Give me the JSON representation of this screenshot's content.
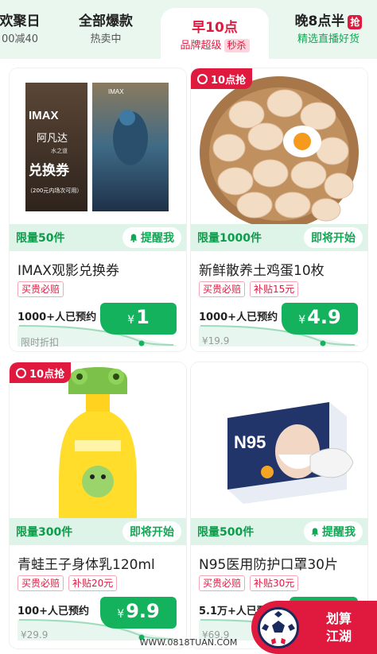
{
  "tabs": [
    {
      "title": "欢聚日",
      "subtitle": "00减40",
      "active": false
    },
    {
      "title": "全部爆款",
      "subtitle": "热卖中",
      "active": false
    },
    {
      "title": "早10点",
      "subtitle": "品牌超级",
      "flash": "秒杀",
      "active": true
    },
    {
      "title": "晚8点半",
      "badge": "抢",
      "subtitle": "精选直播好货",
      "active": false
    }
  ],
  "products": [
    {
      "image": "IMAX阿凡达兑换券",
      "image_text": {
        "brand": "IMAX",
        "movie": "阿凡达",
        "movie_sub": "水之道",
        "voucher": "兑换券",
        "note": "（200元内场次可用）"
      },
      "limit": "限量50件",
      "action": "提醒我",
      "action_icon": "bell-icon",
      "title": "IMAX观影兑换券",
      "tags": [
        "买贵必赔"
      ],
      "booked": "1000+人已预约",
      "currency": "¥",
      "price": "1",
      "sub": "限时折扣",
      "progress": 0.85
    },
    {
      "image": "鸡蛋",
      "badge": "10点抢",
      "limit": "限量1000件",
      "action": "即将开始",
      "title": "新鲜散养土鸡蛋10枚",
      "tags": [
        "买贵必赔",
        "补贴15元"
      ],
      "booked": "1000+人已预约",
      "currency": "¥",
      "price": "4.9",
      "sub": "¥19.9",
      "progress": 0.85
    },
    {
      "image": "青蛙王子身体乳",
      "badge": "10点抢",
      "limit": "限量300件",
      "action": "即将开始",
      "title": "青蛙王子身体乳120ml",
      "tags": [
        "买贵必赔",
        "补贴20元"
      ],
      "booked": "100+人已预约",
      "currency": "¥",
      "price": "9.9",
      "sub": "¥29.9",
      "progress": 0.85
    },
    {
      "image": "N95口罩",
      "limit": "限量500件",
      "action": "提醒我",
      "action_icon": "bell-icon",
      "title": "N95医用防护口罩30片",
      "tags": [
        "买贵必赔",
        "补贴30元"
      ],
      "booked": "5.1万+人已预约",
      "currency": "¥",
      "price": "",
      "sub": "¥69.9",
      "progress": 0.85
    }
  ],
  "promo": {
    "line1": "划算",
    "line2": "江湖"
  },
  "watermark": "WWW.0818TUAN.COM",
  "colors": {
    "accent_red": "#e0193f",
    "accent_green": "#14b25d",
    "strip_green": "#dff4e8"
  }
}
